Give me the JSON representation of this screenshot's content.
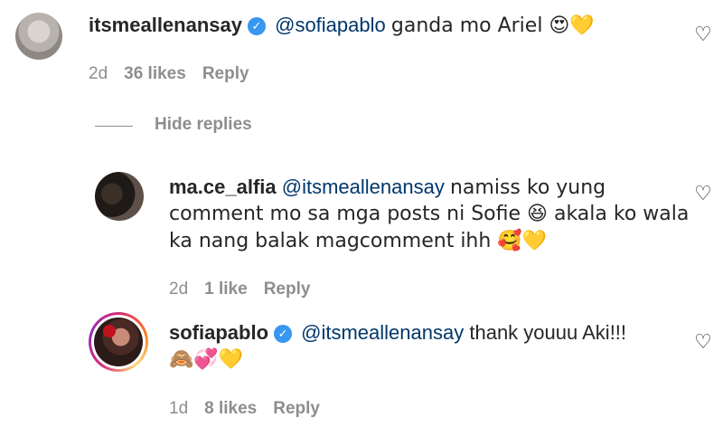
{
  "comments": [
    {
      "username": "itsmeallenansay",
      "verified": true,
      "mention": "@sofiapablo",
      "lines": [
        "ganda mo Ariel 😍💛"
      ],
      "time": "2d",
      "likes": "36 likes",
      "reply_label": "Reply"
    },
    {
      "username": "ma.ce_alfia",
      "verified": false,
      "mention": "@itsmeallenansay",
      "lines": [
        "namiss ko yung",
        "comment mo sa mga posts ni Sofie 😆 akala ko wala",
        "ka nang balak magcomment ihh 🥰💛"
      ],
      "time": "2d",
      "likes": "1 like",
      "reply_label": "Reply"
    },
    {
      "username": "sofiapablo",
      "verified": true,
      "mention": "@itsmeallenansay",
      "lines": [
        "thank youuu Aki!!!",
        "🙈💞💛"
      ],
      "time": "1d",
      "likes": "8 likes",
      "reply_label": "Reply"
    }
  ],
  "hide_replies_label": "Hide replies",
  "icons": {
    "like": "heart-outline-icon",
    "verified": "verified-badge-icon"
  }
}
